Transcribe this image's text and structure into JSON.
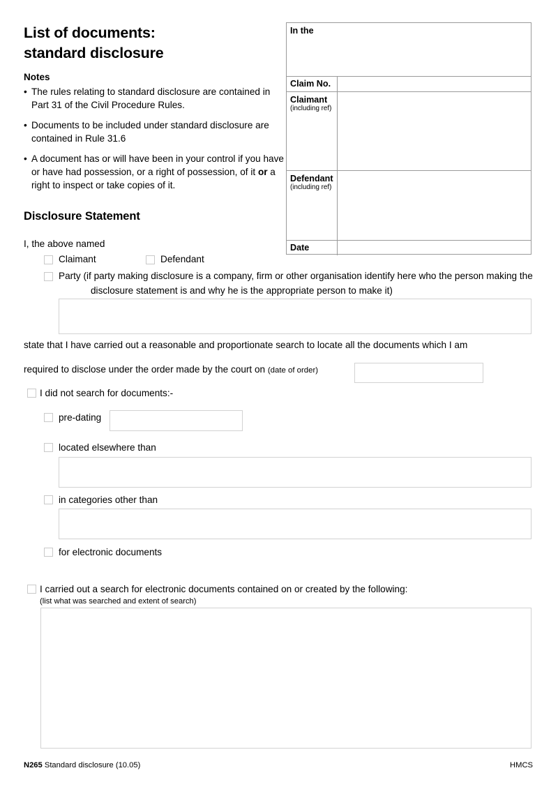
{
  "form": {
    "title_line1": "List of documents:",
    "title_line2": "standard disclosure",
    "notes_heading": "Notes",
    "notes": [
      "The rules relating to standard disclosure are contained in Part 31 of the Civil Procedure Rules.",
      "Documents to be included under standard disclosure are contained in Rule 31.6",
      "A document has or will have been in your control if you have or have had possession, or a right of possession, of it or a right to inspect or take copies of it."
    ],
    "bullet_glyph": "•"
  },
  "court_box": {
    "in_the_label": "In the",
    "claim_no_label": "Claim No.",
    "claimant_label": "Claimant",
    "claimant_sublabel": "(including ref)",
    "defendant_label": "Defendant",
    "defendant_sublabel": "(including ref)",
    "date_label": "Date",
    "in_the_value": "",
    "claim_no_value": "",
    "claimant_value": "",
    "defendant_value": "",
    "date_value": ""
  },
  "disclosure": {
    "section_title": "Disclosure Statement",
    "intro": "I, the above named",
    "claimant_checkbox_label": "Claimant",
    "defendant_checkbox_label": "Defendant",
    "party_checkbox_label_line1": "Party (if party making disclosure is a company, firm or other organisation identify here who the person making the",
    "party_checkbox_label_line2": "disclosure statement is and why he is the appropriate person to make it)",
    "party_detail_value": "",
    "statement_line1": "state that I have carried out a reasonable and proportionate search to locate all the documents which I am",
    "statement_line2_prefix": "required to disclose under the order made by the court on",
    "statement_line2_hint": "(date of order)",
    "date_of_order_value": ""
  },
  "not_searched": {
    "heading_label": "I did not search for documents:-",
    "items": [
      {
        "label": "pre-dating",
        "value": "",
        "field": "inline"
      },
      {
        "label": "located elsewhere than",
        "value": "",
        "field": "block"
      },
      {
        "label": "in categories other than",
        "value": "",
        "field": "block"
      },
      {
        "label": "for electronic documents",
        "value": "",
        "field": "none"
      }
    ]
  },
  "electronic_search": {
    "label": "I carried out a search for electronic documents contained on or created by the following:",
    "hint": "(list what was searched and extent of search)",
    "value": ""
  },
  "footer": {
    "form_code": "N265",
    "form_desc": "Standard disclosure (10.05)",
    "agency": "HMCS"
  }
}
